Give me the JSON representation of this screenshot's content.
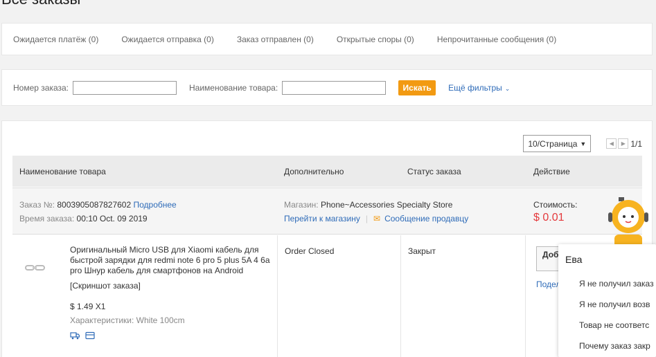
{
  "page": {
    "title": "Все заказы"
  },
  "tabs": [
    "Ожидается платёж (0)",
    "Ожидается отправка (0)",
    "Заказ отправлен (0)",
    "Открытые споры (0)",
    "Непрочитанные сообщения (0)"
  ],
  "filters": {
    "order_number_label": "Номер заказа:",
    "order_number_value": "",
    "product_name_label": "Наименование товара:",
    "product_name_value": "",
    "search_button": "Искать",
    "more_filters": "Ещё фильтры"
  },
  "pager": {
    "page_size": "10/Страница",
    "page_info": "1/1"
  },
  "table_headers": [
    "Наименование товара",
    "Дополнительно",
    "Статус заказа",
    "Действие"
  ],
  "order": {
    "number_label": "Заказ №:",
    "number": "8003905087827602",
    "details_link": "Подробнее",
    "time_label": "Время заказа:",
    "time": "00:10 Oct. 09 2019",
    "shop_label": "Магазин:",
    "shop_name": "Phone~Accessories Specialty Store",
    "go_to_shop": "Перейти к магазину",
    "message_seller": "Сообщение продавцу",
    "cost_label": "Стоимость:",
    "cost": "$ 0.01",
    "item": {
      "name": "Оригинальный Micro USB для Xiaomi кабель для быстрой зарядки для redmi note 6 pro 5 plus 5A 4 6а pro Шнур кабель для смартфонов на Android",
      "screenshot_link": "[Скриншот заказа]",
      "price": "$ 1.49 X1",
      "spec_label": "Характеристики:",
      "spec_value": "White 100cm",
      "extra": "Order Closed",
      "status": "Закрыт",
      "action_button": "Доб",
      "action_link": "Подел"
    }
  },
  "popup": {
    "title": "Ева",
    "options": [
      "Я не получил заказ",
      "Я не получил возв",
      "Товар не соответс",
      "Почему заказ закр"
    ]
  },
  "colors": {
    "accent": "#f29a12",
    "link": "#2e6bb8",
    "price": "#e4393c"
  }
}
